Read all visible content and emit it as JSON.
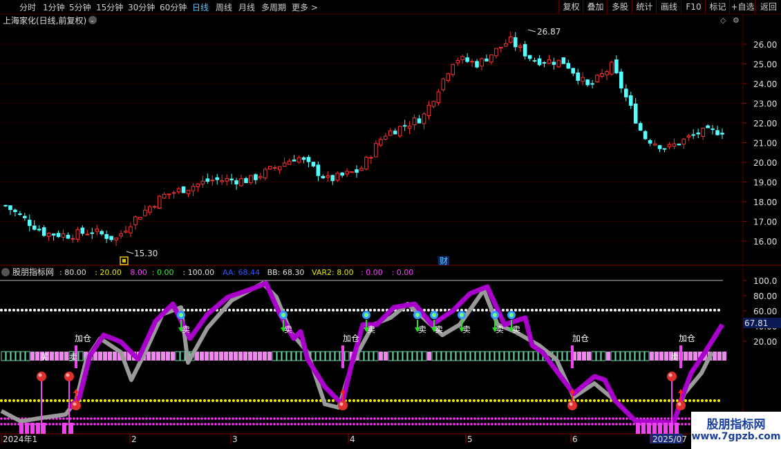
{
  "toolbar": {
    "periods": [
      "分时",
      "1分钟",
      "5分钟",
      "15分钟",
      "30分钟",
      "60分钟",
      "日线",
      "周线",
      "月线",
      "多周期",
      "更多 >"
    ],
    "active_period": "日线",
    "right_buttons": [
      "复权",
      "叠加",
      "多股",
      "统计",
      "画线",
      "F10",
      "标记",
      "+自选",
      "返回"
    ]
  },
  "chart": {
    "title": "上海家化(日线,前复权)",
    "high_label": "26.87",
    "low_label": "15.30",
    "fin_marker": "财",
    "price_ticks": [
      "26.00",
      "25.00",
      "24.00",
      "23.00",
      "22.00",
      "21.00",
      "20.00",
      "19.00",
      "18.00",
      "17.00",
      "16.00"
    ]
  },
  "indicator": {
    "name": "股朋指标网",
    "values": [
      {
        "text": ": 80.00",
        "color": "#e0e0e0"
      },
      {
        "text": ": 20.00",
        "color": "#e8e800"
      },
      {
        "text": "8.00",
        "color": "#ff44ff"
      },
      {
        "text": ": 0.00",
        "color": "#44ee44"
      },
      {
        "text": ": 100.00",
        "color": "#e0e0e0"
      },
      {
        "text": "AA: 68.44",
        "color": "#3355ff"
      },
      {
        "text": "BB: 68.30",
        "color": "#e0e0e0"
      },
      {
        "text": "VAR2: 8.00",
        "color": "#e8e800"
      },
      {
        "text": ": 0.00",
        "color": "#ff44ff"
      },
      {
        "text": ": 0.00",
        "color": "#ff44ff"
      }
    ],
    "ticks": [
      "100.0",
      "80.00",
      "60.00",
      "40.00",
      "20.00"
    ],
    "current": "67.81",
    "label_buy": "买",
    "label_sell": "卖",
    "label_add": "加仓"
  },
  "xaxis": {
    "labels": [
      "2024年1",
      "2",
      "3",
      "4",
      "5",
      "6",
      "2025/07"
    ]
  },
  "watermark": {
    "title": "股朋指标网",
    "url": "www.7gpzb.com"
  },
  "colors": {
    "up": "#ff3232",
    "down": "#54ffff",
    "grid": "#5a0000",
    "accent": "#5fc8ff"
  }
}
